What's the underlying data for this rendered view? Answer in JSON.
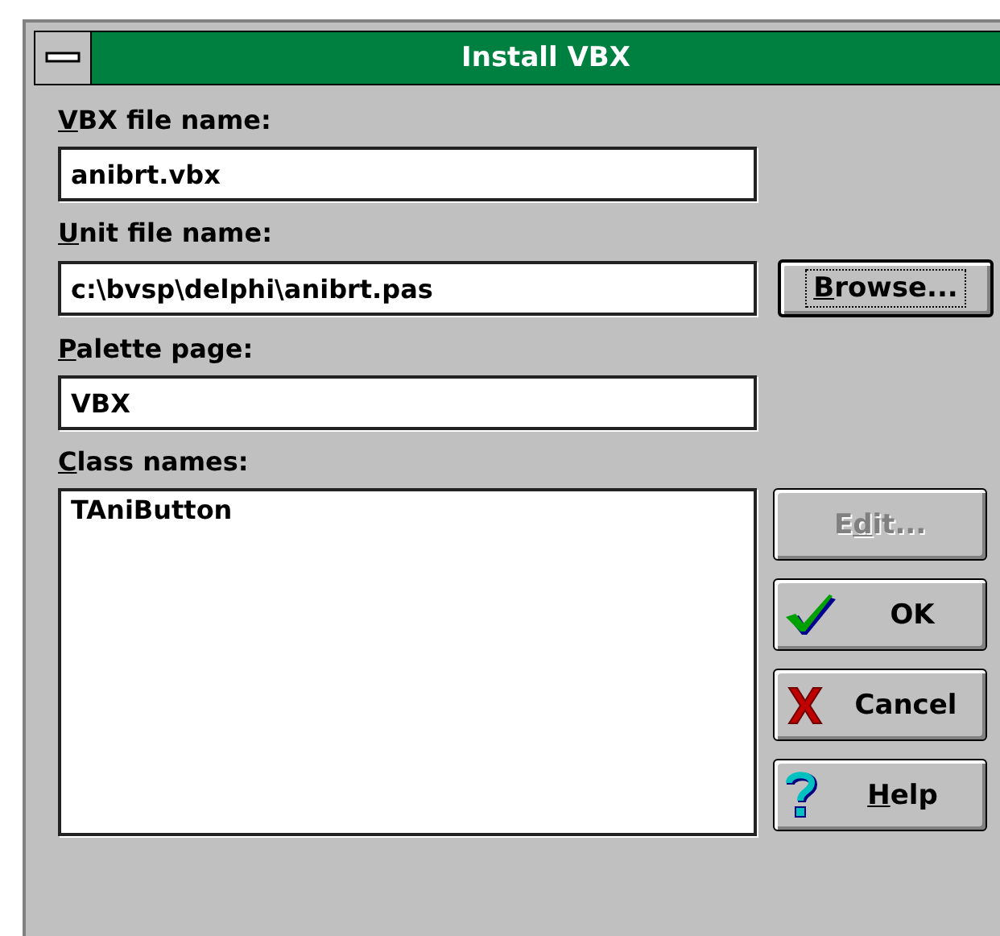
{
  "window": {
    "title": "Install VBX"
  },
  "fields": [
    {
      "label": {
        "key": "V",
        "rest": "BX file name:"
      },
      "value": "anibrt.vbx"
    },
    {
      "label": {
        "key": "U",
        "rest": "nit file name:"
      },
      "value": "c:\\bvsp\\delphi\\anibrt.pas"
    },
    {
      "label": {
        "key": "P",
        "rest": "alette page:"
      },
      "value": "VBX"
    }
  ],
  "browse_button": {
    "label": {
      "key": "B",
      "rest": "rowse..."
    },
    "focused": true
  },
  "class_names": {
    "label": {
      "key": "C",
      "rest": "lass names:"
    },
    "items": [
      {
        "text": "TAniButton",
        "selected": false
      }
    ]
  },
  "buttons": [
    {
      "kind": "plain",
      "label": {
        "before": "E",
        "key": "d",
        "rest": "it..."
      },
      "disabled": true
    },
    {
      "kind": "ok",
      "label": {
        "rest": "OK"
      },
      "disabled": false
    },
    {
      "kind": "cancel",
      "label": {
        "rest": "Cancel"
      },
      "disabled": false
    },
    {
      "kind": "help",
      "label": {
        "key": "H",
        "rest": "elp"
      },
      "disabled": false
    }
  ]
}
